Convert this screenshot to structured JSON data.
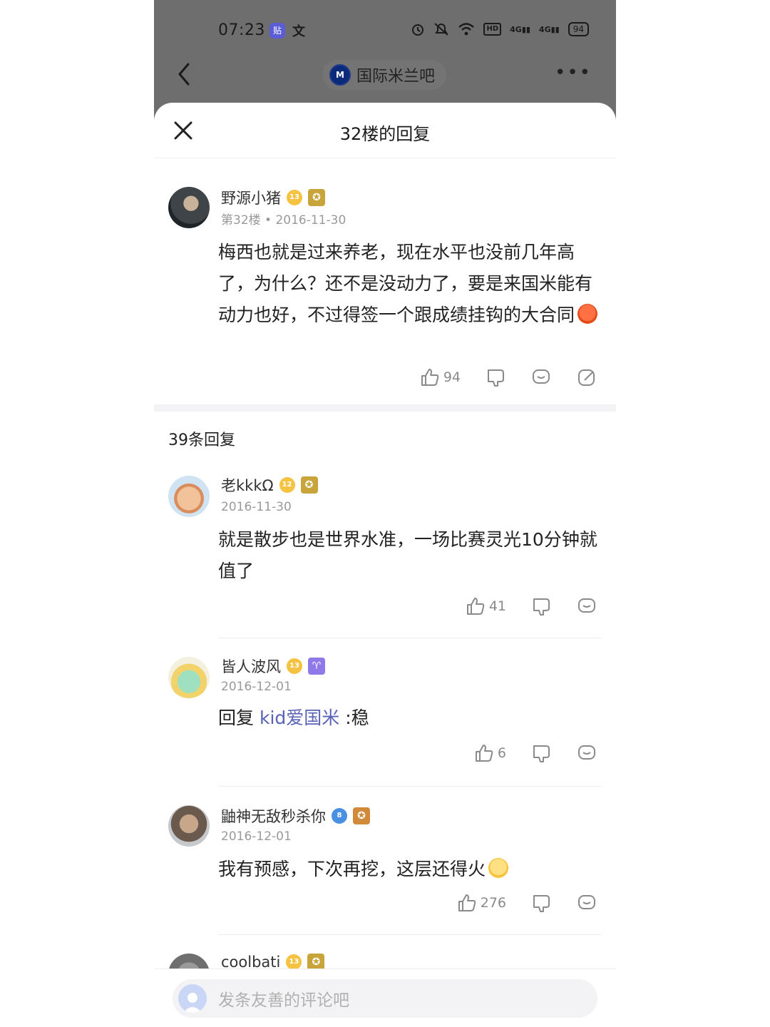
{
  "status_bar": {
    "time": "07:23",
    "app1": "贴",
    "app2": "文",
    "network": "4G",
    "hd": "HD",
    "battery": "94"
  },
  "nav": {
    "forum_logo": "M",
    "forum_name": "国际米兰吧",
    "more": "•••"
  },
  "sheet": {
    "title": "32楼的回复"
  },
  "main_post": {
    "username": "野源小猪",
    "level": "13",
    "floor_meta": "第32楼 • 2016-11-30",
    "content": "梅西也就是过来养老，现在水平也没前几年高了，为什么？还不是没动力了，要是来国米能有动力也好，不过得签一个跟成绩挂钩的大合同",
    "likes": "94"
  },
  "replies_header": "39条回复",
  "replies": [
    {
      "username": "老kkkΩ",
      "level": "12",
      "date": "2016-11-30",
      "content": "就是散步也是世界水准，一场比赛灵光10分钟就值了",
      "likes": "41"
    },
    {
      "username": "皆人波风",
      "level": "13",
      "date": "2016-12-01",
      "prefix": "回复",
      "mention": "kid爱国米",
      "content": ":稳",
      "badge": "♈",
      "likes": "6"
    },
    {
      "username": "鼬神无敌秒杀你",
      "level": "8",
      "date": "2016-12-01",
      "content": "我有预感，下次再挖，这层还得火",
      "likes": "276"
    },
    {
      "username": "coolbati",
      "level": "13"
    }
  ],
  "bottom": {
    "placeholder": "发条友善的评论吧"
  },
  "colors": {
    "dim": "#6e6e6e",
    "link": "#5a63b8",
    "level_gold": "#f5c242",
    "level_blue": "#4a90e2"
  }
}
